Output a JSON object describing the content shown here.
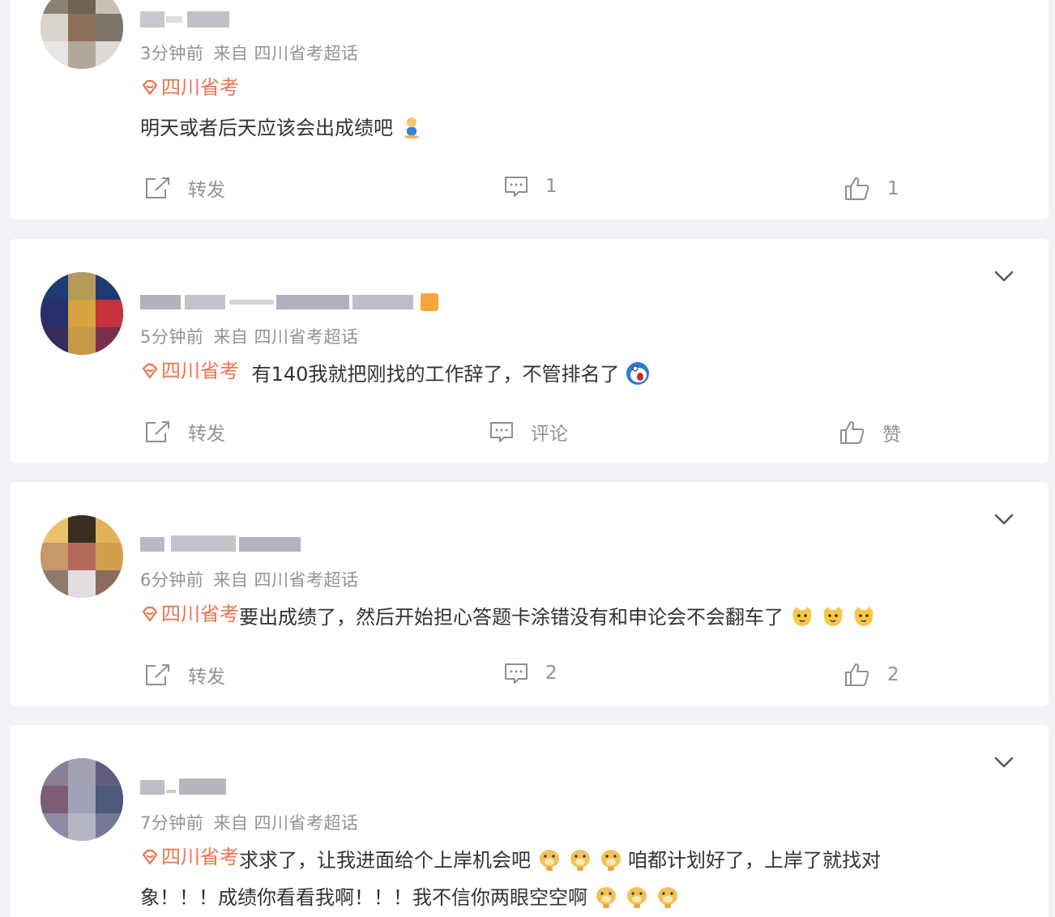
{
  "posts": [
    {
      "time": "3分钟前",
      "source": "来自 四川省考超话",
      "topic": "四川省考",
      "content": "明天或者后天应该会出成绩吧",
      "emojis": [
        "figure-emoji"
      ],
      "actions": {
        "repost": "转发",
        "comment": "1",
        "like": "1"
      }
    },
    {
      "time": "5分钟前",
      "source": "来自 四川省考超话",
      "topic": "四川省考",
      "content": "有140我就把刚找的工作辞了，不管排名了",
      "emojis": [
        "doraemon-emoji"
      ],
      "actions": {
        "repost": "转发",
        "comment": "评论",
        "like": "赞"
      }
    },
    {
      "time": "6分钟前",
      "source": "来自 四川省考超话",
      "topic": "四川省考",
      "content": "要出成绩了，然后开始担心答题卡涂错没有和申论会不会翻车了",
      "emojis": [
        "cat-emoji",
        "cat-emoji",
        "cat-emoji"
      ],
      "actions": {
        "repost": "转发",
        "comment": "2",
        "like": "2"
      }
    },
    {
      "time": "7分钟前",
      "source": "来自 四川省考超话",
      "topic": "四川省考",
      "content_line1_a": "求求了，让我进面给个上岸机会吧",
      "content_line1_b": "咱都计划好了，上岸了就找对",
      "content_line2": "象！！！成绩你看看我啊！！！我不信你两眼空空啊",
      "emojis": [
        "doge-pray-emoji",
        "doge-pray-emoji",
        "doge-pray-emoji"
      ]
    }
  ],
  "colors": {
    "topic": "#eb7350",
    "meta": "#939393",
    "text": "#333333",
    "background": "#f1f2f5"
  }
}
